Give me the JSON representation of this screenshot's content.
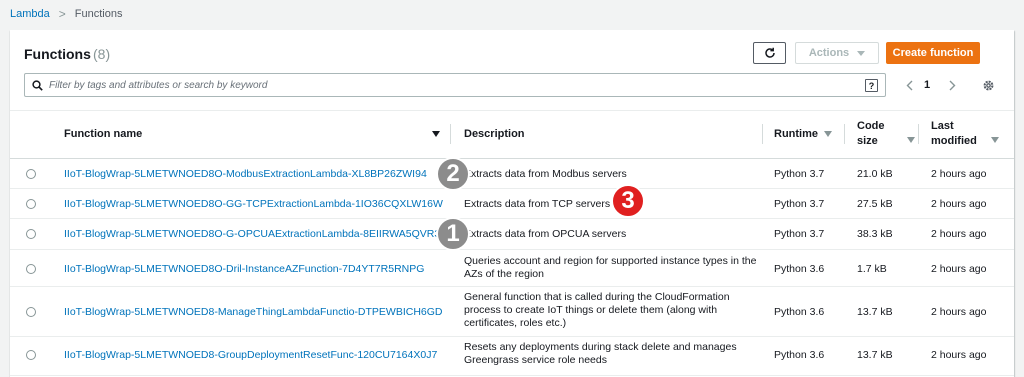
{
  "breadcrumb": {
    "root": "Lambda",
    "current": "Functions"
  },
  "panel": {
    "title": "Functions",
    "count": "(8)",
    "actions_label": "Actions",
    "create_label": "Create function",
    "search_placeholder": "Filter by tags and attributes or search by keyword",
    "help_label": "?",
    "page": "1"
  },
  "columns": {
    "name": "Function name",
    "description": "Description",
    "runtime": "Runtime",
    "code_size_1": "Code",
    "code_size_2": "size",
    "modified_1": "Last",
    "modified_2": "modified"
  },
  "rows": [
    {
      "name": "IIoT-BlogWrap-5LMETWNOED8O-ModbusExtractionLambda-XL8BP26ZWI94",
      "desc": "Extracts data from Modbus servers",
      "runtime": "Python 3.7",
      "size": "21.0 kB",
      "modified": "2 hours ago"
    },
    {
      "name": "IIoT-BlogWrap-5LMETWNOED8O-GG-TCPExtractionLambda-1IO36CQXLW16W",
      "desc": "Extracts data from TCP servers",
      "runtime": "Python 3.7",
      "size": "27.5 kB",
      "modified": "2 hours ago"
    },
    {
      "name": "IIoT-BlogWrap-5LMETWNOED8O-G-OPCUAExtractionLambda-8EIIRWA5QVR3",
      "desc": "Extracts data from OPCUA servers",
      "runtime": "Python 3.7",
      "size": "38.3 kB",
      "modified": "2 hours ago"
    },
    {
      "name": "IIoT-BlogWrap-5LMETWNOED8O-Dril-InstanceAZFunction-7D4YT7R5RNPG",
      "desc": "Queries account and region for supported instance types in the AZs of the region",
      "runtime": "Python 3.6",
      "size": "1.7 kB",
      "modified": "2 hours ago"
    },
    {
      "name": "IIoT-BlogWrap-5LMETWNOED8-ManageThingLambdaFunctio-DTPEWBICH6GD",
      "desc": "General function that is called during the CloudFormation process to create IoT things or delete them (along with certificates, roles etc.)",
      "runtime": "Python 3.6",
      "size": "13.7 kB",
      "modified": "2 hours ago"
    },
    {
      "name": "IIoT-BlogWrap-5LMETWNOED8-GroupDeploymentResetFunc-120CU7164X0J7",
      "desc": "Resets any deployments during stack delete and manages Greengrass service role needs",
      "runtime": "Python 3.6",
      "size": "13.7 kB",
      "modified": "2 hours ago"
    }
  ],
  "annotations": {
    "one": "1",
    "two": "2",
    "three": "3"
  },
  "colors": {
    "link": "#0073bb",
    "primary_button": "#ec7211",
    "badge_grey": "#8c8c8c",
    "badge_red": "#e02020"
  }
}
